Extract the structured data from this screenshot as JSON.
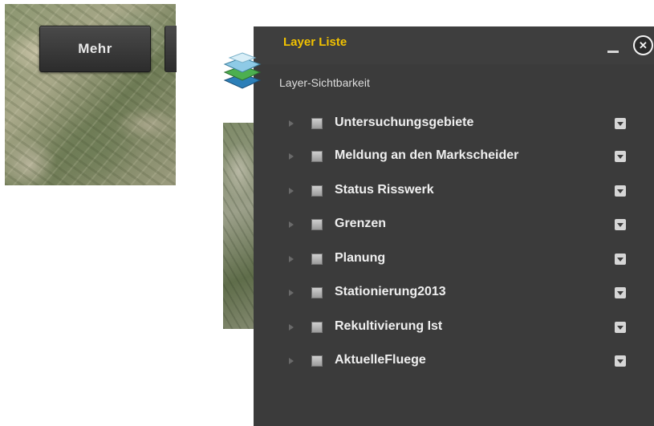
{
  "map_toolbar": {
    "more_button_label": "Mehr"
  },
  "layer_panel": {
    "title": "Layer Liste",
    "visibility_label": "Layer-Sichtbarkeit",
    "title_color": "#f2c200",
    "panel_color": "#3b3b3b",
    "layers": [
      {
        "label": "Untersuchungsgebiete"
      },
      {
        "label": "Meldung an den Markscheider"
      },
      {
        "label": "Status Risswerk"
      },
      {
        "label": "Grenzen"
      },
      {
        "label": "Planung"
      },
      {
        "label": "Stationierung2013"
      },
      {
        "label": "Rekultivierung Ist"
      },
      {
        "label": "AktuelleFluege"
      }
    ]
  },
  "icons": [
    "layer-stack-icon",
    "minimize-icon",
    "close-icon",
    "expand-arrow-icon",
    "checkbox-icon",
    "dropdown-icon"
  ]
}
